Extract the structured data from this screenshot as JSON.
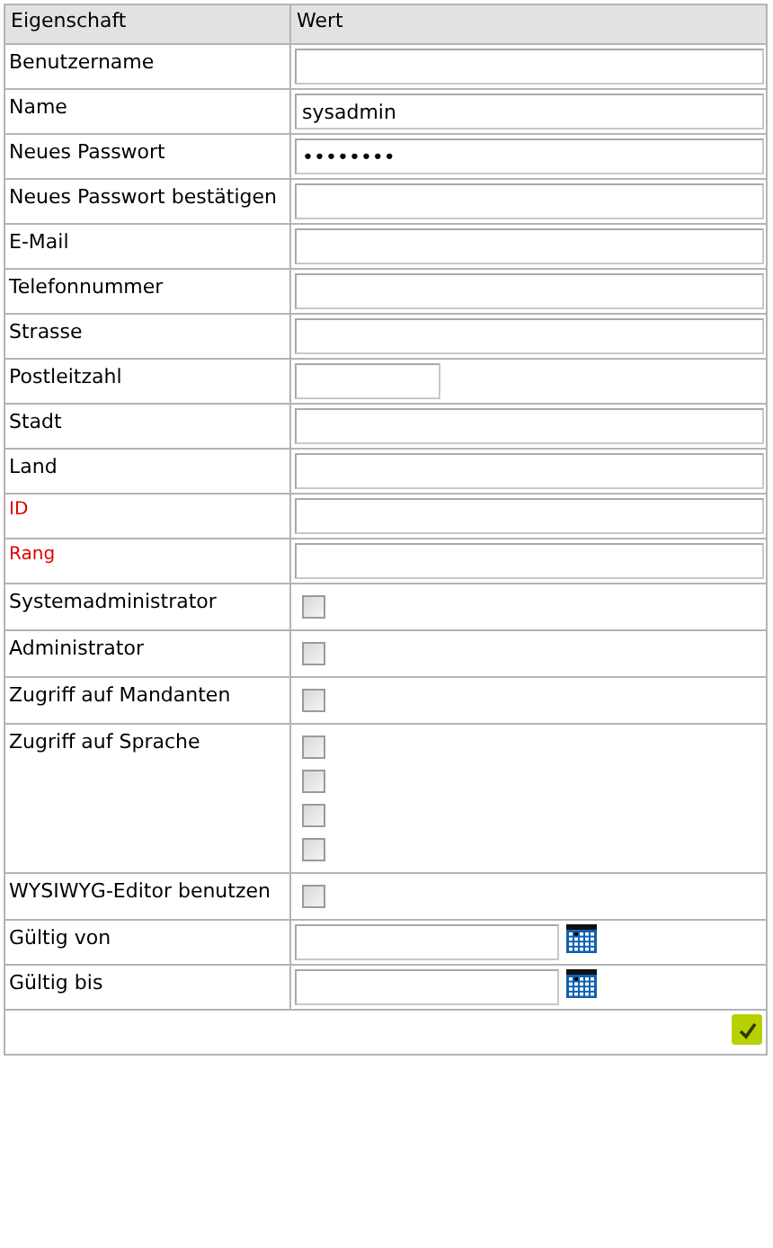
{
  "table": {
    "columns": [
      "Eigenschaft",
      "Wert"
    ],
    "rows": [
      {
        "kind": "text",
        "label": "Benutzername",
        "required": false
      },
      {
        "kind": "text",
        "label": "Name",
        "value": "sysadmin",
        "required": false
      },
      {
        "kind": "text",
        "label": "Neues Passwort",
        "value": "••••••••",
        "required": false
      },
      {
        "kind": "text",
        "label": "Neues Passwort bestätigen",
        "required": false
      },
      {
        "kind": "text",
        "label": "E-Mail",
        "required": false
      },
      {
        "kind": "text",
        "label": "Telefonnummer",
        "required": false
      },
      {
        "kind": "text",
        "label": "Strasse",
        "required": false
      },
      {
        "kind": "short",
        "label": "Postleitzahl",
        "required": false
      },
      {
        "kind": "text",
        "label": "Stadt",
        "required": false
      },
      {
        "kind": "text",
        "label": "Land",
        "required": false
      },
      {
        "kind": "text",
        "label": "ID",
        "required": true
      },
      {
        "kind": "text",
        "label": "Rang",
        "required": true
      },
      {
        "kind": "checkbox",
        "label": "Systemadministrator",
        "checks": [
          false
        ]
      },
      {
        "kind": "checkbox",
        "label": "Administrator",
        "checks": [
          false
        ]
      },
      {
        "kind": "checkbox",
        "label": "Zugriff auf Mandanten",
        "checks": [
          false
        ]
      },
      {
        "kind": "checkbox",
        "label": "Zugriff auf Sprache",
        "checks": [
          false,
          false,
          false,
          false
        ]
      },
      {
        "kind": "checkbox",
        "label": "WYSIWYG-Editor benutzen",
        "checks": [
          false
        ]
      },
      {
        "kind": "date",
        "label": "Gültig von"
      },
      {
        "kind": "date",
        "label": "Gültig bis"
      }
    ]
  }
}
